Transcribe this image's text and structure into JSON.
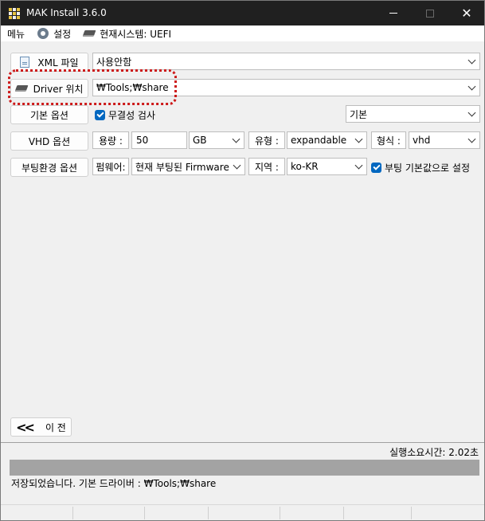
{
  "window": {
    "title": "MAK Install 3.6.0"
  },
  "menu": {
    "menu_label": "메뉴",
    "settings_label": "설정",
    "system_label": "현재시스템: UEFI"
  },
  "rows": {
    "xml": {
      "button": "XML 파일",
      "value": "사용안함"
    },
    "driver": {
      "button": "Driver 위치",
      "value": "₩Tools;₩share"
    },
    "basic": {
      "button": "기본 옵션",
      "check_label": "무결성 검사",
      "combo_value": "기본"
    },
    "vhd": {
      "button": "VHD 옵션",
      "size_label": "용량 :",
      "size_value": "50",
      "unit_value": "GB",
      "type_label": "유형 :",
      "type_value": "expandable",
      "format_label": "형식 :",
      "format_value": "vhd"
    },
    "boot": {
      "button": "부팅환경 옵션",
      "firmware_label": "펌웨어:",
      "firmware_value": "현재 부팅된 Firmware",
      "region_label": "지역 :",
      "region_value": "ko-KR",
      "default_check_label": "부팅 기본값으로 설정"
    }
  },
  "nav": {
    "prev_label": "이 전"
  },
  "status": {
    "elapsed": "실행소요시간: 2.02초",
    "message": "저장되었습니다. 기본 드라이버 : ₩Tools;₩share"
  },
  "colors": {
    "highlight": "#cc1a1a",
    "accent": "#0067c0",
    "titlebar": "#202020"
  }
}
